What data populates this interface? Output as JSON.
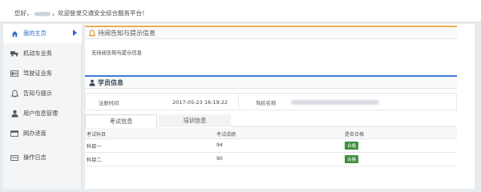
{
  "header": {
    "greeting": "您好，",
    "suffix": "，欢迎登录交通安全综合服务平台！"
  },
  "sidebar": {
    "items": [
      {
        "label": "我的主页",
        "icon": "home-icon",
        "active": true
      },
      {
        "label": "机动车业务",
        "icon": "truck-icon"
      },
      {
        "label": "驾驶证业务",
        "icon": "id-card-icon"
      },
      {
        "label": "告知与提示",
        "icon": "bell-icon"
      },
      {
        "label": "用户信息管理",
        "icon": "user-icon"
      },
      {
        "label": "网办进度",
        "icon": "progress-icon"
      },
      {
        "label": "操作日志",
        "icon": "log-icon"
      }
    ]
  },
  "notifications": {
    "title": "待阅告知与提示信息",
    "empty_text": "无待阅告知与提示信息"
  },
  "student": {
    "title": "学员信息",
    "reg_time_label": "注册时间",
    "reg_time_value": "2017-05-23 16:19:22",
    "school_label": "驾校名称"
  },
  "tabs": [
    {
      "label": "考试信息",
      "active": true
    },
    {
      "label": "培训信息",
      "active": false
    }
  ],
  "exam_table": {
    "columns": [
      "考试科目",
      "考试成绩",
      "是否合格"
    ],
    "rows": [
      {
        "subject": "科目一",
        "score": "94",
        "passed": "合格"
      },
      {
        "subject": "科目二",
        "score": "90",
        "passed": "合格"
      }
    ]
  },
  "colors": {
    "accent": "#3b7dd8",
    "warning_bar": "#f0ad4e",
    "pass_badge": "#3e8f3e"
  }
}
